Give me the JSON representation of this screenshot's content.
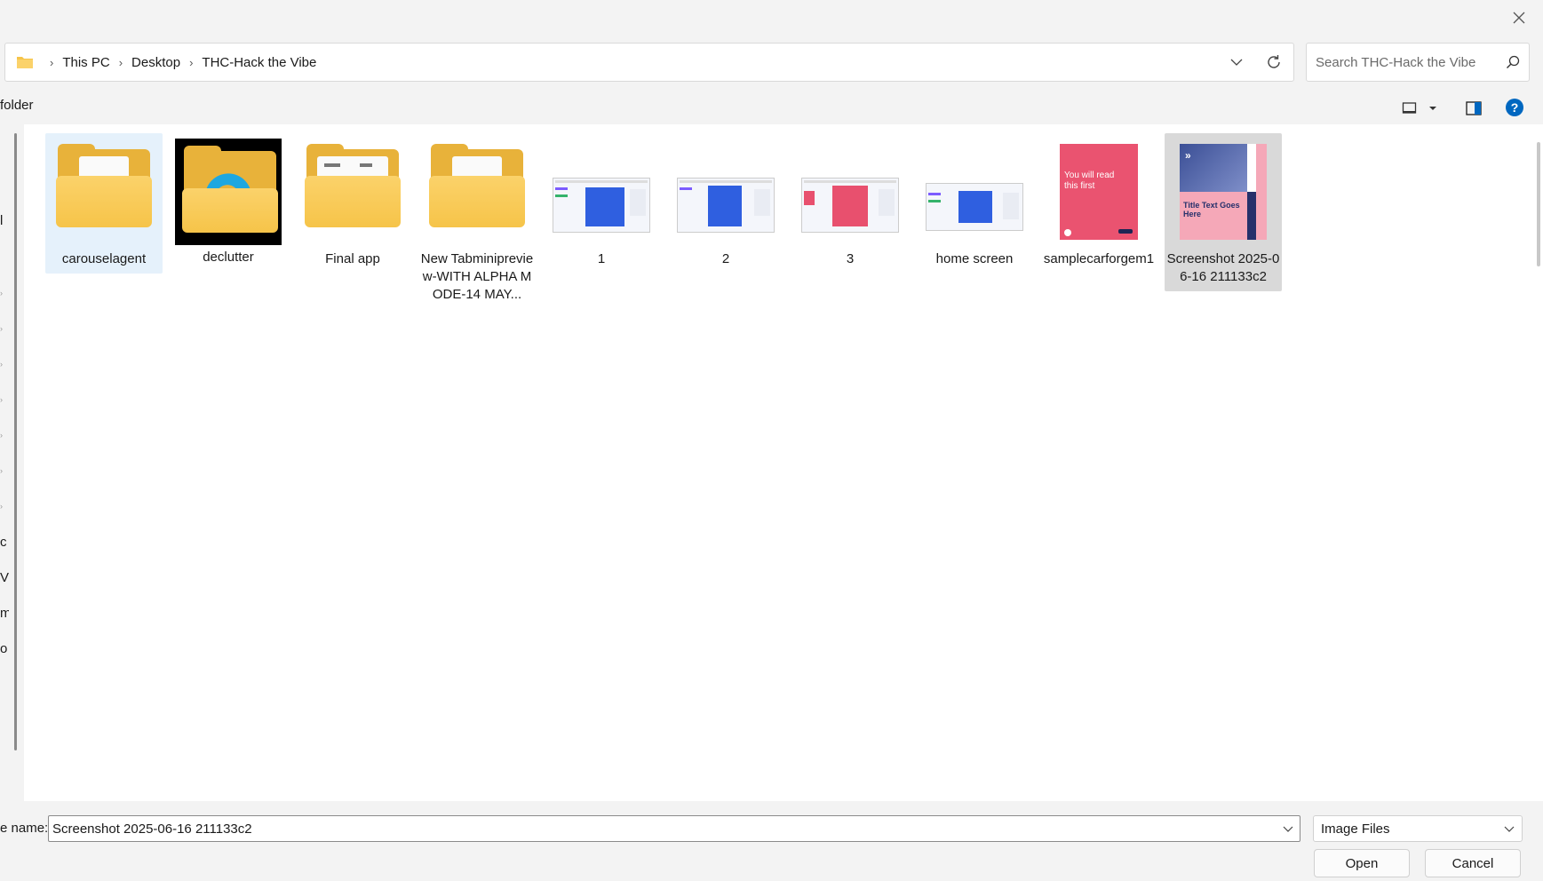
{
  "breadcrumb": [
    "This PC",
    "Desktop",
    "THC-Hack the Vibe"
  ],
  "search": {
    "placeholder": "Search THC-Hack the Vibe"
  },
  "command_bar": {
    "new_folder_fragment": "folder"
  },
  "nav_fragments": [
    "l",
    "c",
    "V",
    "m",
    "o"
  ],
  "items": [
    {
      "label": "carouselagent",
      "kind": "folder",
      "selected": "hover"
    },
    {
      "label": "declutter",
      "kind": "folder-dark"
    },
    {
      "label": "Final app",
      "kind": "folder"
    },
    {
      "label": "New Tabminipreview-WITH ALPHA MODE-14 MAY...",
      "kind": "folder"
    },
    {
      "label": "1",
      "kind": "image"
    },
    {
      "label": "2",
      "kind": "image"
    },
    {
      "label": "3",
      "kind": "image"
    },
    {
      "label": "home screen",
      "kind": "image"
    },
    {
      "label": "samplecarforgem1",
      "kind": "image-pink"
    },
    {
      "label": "Screenshot 2025-06-16 211133c2",
      "kind": "image-blue",
      "selected": "selected"
    }
  ],
  "thumb_text": {
    "sample_line1": "You will read",
    "sample_line2": "this first",
    "shot_title": "Title Text Goes Here"
  },
  "bottom": {
    "filename_label": "e name:",
    "filename_value": "Screenshot 2025-06-16 211133c2",
    "filetype": "Image Files",
    "open": "Open",
    "cancel": "Cancel"
  },
  "colors": {
    "accent": "#0067c0",
    "folder": "#f6c449",
    "selection": "#e5f1fb"
  }
}
